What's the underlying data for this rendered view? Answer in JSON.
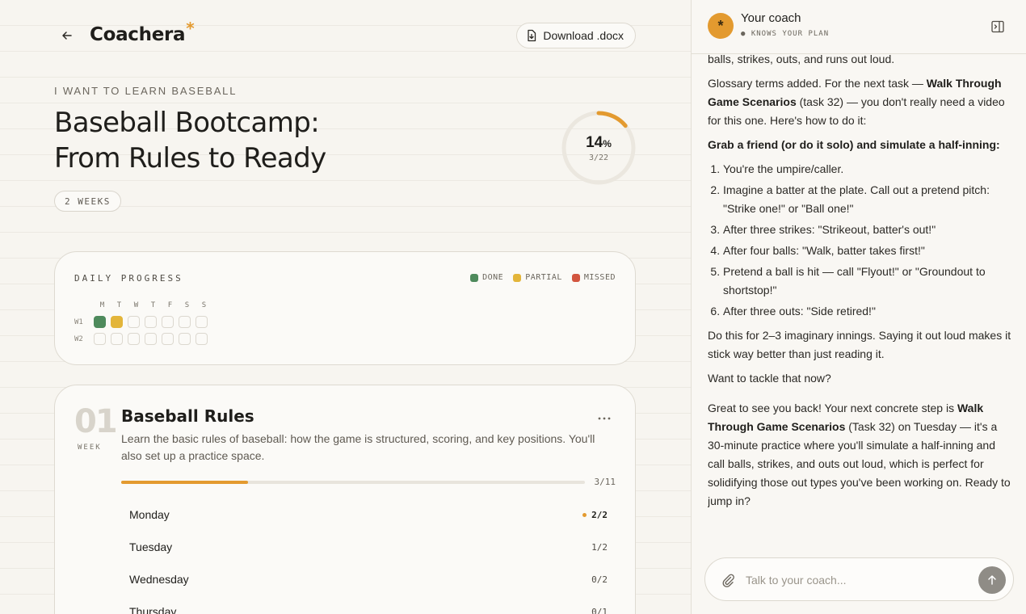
{
  "app": {
    "brand": "Coachera",
    "brand_mark": "*"
  },
  "toolbar": {
    "download_label": "Download .docx"
  },
  "plan": {
    "eyebrow": "I WANT TO LEARN BASEBALL",
    "title_line1": "Baseball Bootcamp:",
    "title_line2": "From Rules to Ready",
    "duration": "2 WEEKS",
    "progress_pct": "14",
    "progress_unit": "%",
    "progress_fraction": 0.14,
    "progress_count": "3/22"
  },
  "daily_progress": {
    "title": "DAILY PROGRESS",
    "legend": {
      "done": "DONE",
      "partial": "PARTIAL",
      "missed": "MISSED"
    },
    "colors": {
      "done": "#4e8a5c",
      "partial": "#e3b53a",
      "missed": "#d2553f",
      "accent": "#e39a2f"
    },
    "day_headers": [
      "M",
      "T",
      "W",
      "T",
      "F",
      "S",
      "S"
    ],
    "rows": [
      {
        "label": "W1",
        "cells": [
          "done",
          "partial",
          "empty",
          "empty",
          "empty",
          "empty",
          "empty"
        ]
      },
      {
        "label": "W2",
        "cells": [
          "empty",
          "empty",
          "empty",
          "empty",
          "empty",
          "empty",
          "empty"
        ]
      }
    ]
  },
  "week": {
    "number": "01",
    "label": "WEEK",
    "title": "Baseball Rules",
    "description": "Learn the basic rules of baseball: how the game is structured, scoring, and key positions. You'll also set up a practice space.",
    "progress_count": "3/11",
    "progress_fraction": 0.2727,
    "days": [
      {
        "name": "Monday",
        "count": "2/2"
      },
      {
        "name": "Tuesday",
        "count": "1/2"
      },
      {
        "name": "Wednesday",
        "count": "0/2"
      },
      {
        "name": "Thursday",
        "count": "0/1"
      }
    ]
  },
  "coach": {
    "avatar": "*",
    "name": "Your coach",
    "subtitle": "● KNOWS YOUR PLAN",
    "msg1": {
      "p0": "balls, strikes, outs, and runs out loud.",
      "p1_a": "Glossary terms added. For the next task — ",
      "p1_b": "Walk Through Game Scenarios",
      "p1_c": " (task 32) — you don't really need a video for this one. Here's how to do it:",
      "p2": "Grab a friend (or do it solo) and simulate a half-inning:",
      "steps": [
        "You're the umpire/caller.",
        "Imagine a batter at the plate. Call out a pretend pitch: \"Strike one!\" or \"Ball one!\"",
        "After three strikes: \"Strikeout, batter's out!\"",
        "After four balls: \"Walk, batter takes first!\"",
        "Pretend a ball is hit — call \"Flyout!\" or \"Groundout to shortstop!\"",
        "After three outs: \"Side retired!\""
      ],
      "p3": "Do this for 2–3 imaginary innings. Saying it out loud makes it stick way better than just reading it.",
      "p4": "Want to tackle that now?"
    },
    "msg2": {
      "a": "Great to see you back! Your next concrete step is ",
      "b": "Walk Through Game Scenarios",
      "c": " (Task 32) on Tuesday — it's a 30-minute practice where you'll simulate a half-inning and call balls, strikes, and outs out loud, which is perfect for solidifying those out types you've been working on. Ready to jump in?"
    },
    "input_placeholder": "Talk to your coach..."
  }
}
